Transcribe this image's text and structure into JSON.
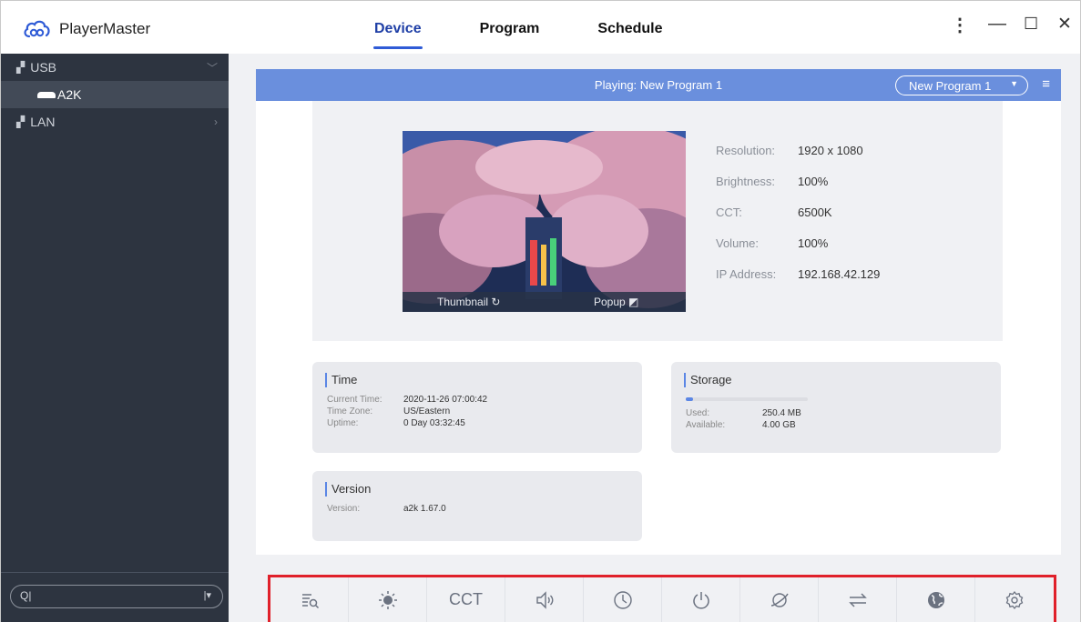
{
  "app": {
    "title": "PlayerMaster"
  },
  "tabs": [
    {
      "label": "Device",
      "active": true
    },
    {
      "label": "Program",
      "active": false
    },
    {
      "label": "Schedule",
      "active": false
    }
  ],
  "sidebar": {
    "items": [
      {
        "label": "USB",
        "icon": "network-icon",
        "chevron": "chevron-down-icon"
      },
      {
        "label": "A2K",
        "icon": "device-icon",
        "selected": true
      },
      {
        "label": "LAN",
        "icon": "network-icon",
        "chevron": "chevron-right-icon"
      }
    ],
    "search": {
      "value": ""
    }
  },
  "playbar": {
    "playing_text": "Playing: New Program 1",
    "program_select": "New Program 1"
  },
  "thumbnail": {
    "thumbnail_label": "Thumbnail",
    "popup_label": "Popup"
  },
  "device_info": [
    {
      "label": "Resolution:",
      "value": "1920 x 1080"
    },
    {
      "label": "Brightness:",
      "value": "100%"
    },
    {
      "label": "CCT:",
      "value": "6500K"
    },
    {
      "label": "Volume:",
      "value": "100%"
    },
    {
      "label": "IP Address:",
      "value": "192.168.42.129"
    }
  ],
  "time_card": {
    "title": "Time",
    "rows": [
      {
        "label": "Current Time:",
        "value": "2020-11-26 07:00:42"
      },
      {
        "label": "Time Zone:",
        "value": "US/Eastern"
      },
      {
        "label": "Uptime:",
        "value": "0 Day 03:32:45"
      }
    ]
  },
  "storage_card": {
    "title": "Storage",
    "used_fraction": 0.06,
    "rows": [
      {
        "label": "Used:",
        "value": "250.4 MB"
      },
      {
        "label": "Available:",
        "value": "4.00 GB"
      }
    ]
  },
  "version_card": {
    "title": "Version",
    "rows": [
      {
        "label": "Version:",
        "value": "a2k 1.67.0"
      }
    ]
  },
  "toolbar": {
    "tools": [
      {
        "icon": "search-list-icon"
      },
      {
        "icon": "brightness-icon"
      },
      {
        "icon": "cct-icon",
        "text": "CCT"
      },
      {
        "icon": "volume-icon"
      },
      {
        "icon": "clock-icon"
      },
      {
        "icon": "power-icon"
      },
      {
        "icon": "planet-icon"
      },
      {
        "icon": "transfer-icon"
      },
      {
        "icon": "globe-icon"
      },
      {
        "icon": "settings-icon"
      }
    ]
  },
  "colors": {
    "sidebar_bg": "#2d3440",
    "accent": "#2f5bd6",
    "playbar_bg": "#6a8fdd",
    "highlight_border": "#e0202a"
  }
}
